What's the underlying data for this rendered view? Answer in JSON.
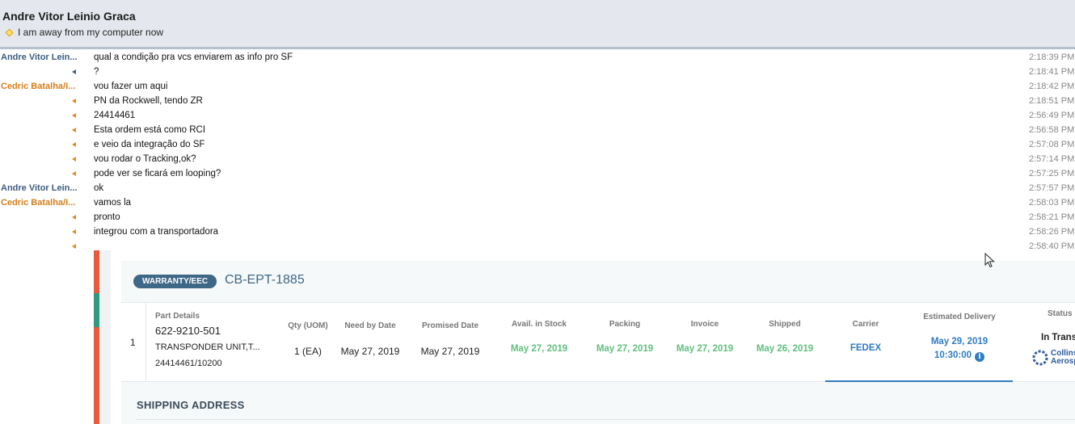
{
  "header": {
    "contact_name": "Andre Vitor Leinio Graca",
    "status_message": "I am away from my computer now"
  },
  "messages": [
    {
      "sender": "Andre Vitor Lein...",
      "who": "andre",
      "text": "qual a condição pra vcs enviarem  as info pro SF",
      "time": "2:18:39 PM"
    },
    {
      "sender": "",
      "who": "andre",
      "text": "?",
      "time": "2:18:41 PM"
    },
    {
      "sender": "Cedric Batalha/I...",
      "who": "cedric",
      "text": "vou fazer um aqui",
      "time": "2:18:42 PM"
    },
    {
      "sender": "",
      "who": "cedric",
      "text": "PN da Rockwell, tendo ZR",
      "time": "2:18:51 PM"
    },
    {
      "sender": "",
      "who": "cedric",
      "text": "24414461",
      "time": "2:56:49 PM"
    },
    {
      "sender": "",
      "who": "cedric",
      "text": "Esta ordem está como RCI",
      "time": "2:56:58 PM"
    },
    {
      "sender": "",
      "who": "cedric",
      "text": "e veio da integração do SF",
      "time": "2:57:08 PM"
    },
    {
      "sender": "",
      "who": "cedric",
      "text": "vou rodar o Tracking,ok?",
      "time": "2:57:14 PM"
    },
    {
      "sender": "",
      "who": "cedric",
      "text": "pode ver se ficará em looping?",
      "time": "2:57:25 PM"
    },
    {
      "sender": "Andre Vitor Lein...",
      "who": "andre",
      "text": "ok",
      "time": "2:57:57 PM"
    },
    {
      "sender": "Cedric Batalha/I...",
      "who": "cedric",
      "text": "vamos la",
      "time": "2:58:03 PM"
    },
    {
      "sender": "",
      "who": "cedric",
      "text": "pronto",
      "time": "2:58:21 PM"
    },
    {
      "sender": "",
      "who": "cedric",
      "text": "integrou com a transportadora",
      "time": "2:58:26 PM"
    },
    {
      "sender": "",
      "who": "cedric",
      "text": "",
      "time": "2:58:40 PM"
    }
  ],
  "order": {
    "badge": "WARRANTY/EEC",
    "id": "CB-EPT-1885",
    "columns": {
      "part_details": "Part Details",
      "qty": "Qty (UOM)",
      "need_by": "Need by Date",
      "promised": "Promised Date",
      "avail": "Avail. in Stock",
      "packing": "Packing",
      "invoice": "Invoice",
      "shipped": "Shipped",
      "carrier": "Carrier",
      "est_delivery": "Estimated Delivery",
      "status": "Status"
    },
    "line": {
      "index": "1",
      "part_number": "622-9210-501",
      "part_desc": "TRANSPONDER UNIT,T...",
      "ref": "24414461/10200",
      "qty": "1 (EA)",
      "need_by": "May 27, 2019",
      "promised": "May 27, 2019",
      "avail": "May 27, 2019",
      "packing": "May 27, 2019",
      "invoice": "May 27, 2019",
      "shipped": "May 26, 2019",
      "carrier": "FEDEX",
      "est_date": "May 29, 2019",
      "est_time": "10:30:00",
      "status": "In Trans",
      "logo_line1": "Collins",
      "logo_line2": "Aerosp"
    },
    "shipping_heading": "SHIPPING ADDRESS"
  },
  "colors": {
    "andre": "#3b5d82",
    "cedric": "#d67e1a",
    "accent": "#2f7cc0",
    "green": "#5fbf7d"
  }
}
